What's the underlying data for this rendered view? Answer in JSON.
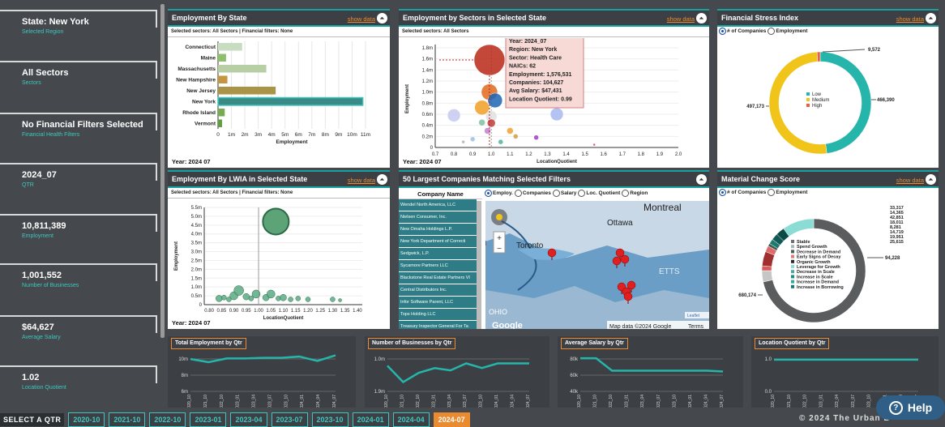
{
  "sidebar": [
    {
      "value": "State: New York",
      "sub": "Selected Region"
    },
    {
      "value": "All Sectors",
      "sub": "Sectors"
    },
    {
      "value": "No Financial Filters Selected",
      "sub": "Financial Health Filters"
    },
    {
      "value": "2024_07",
      "sub": "QTR"
    },
    {
      "value": "10,811,389",
      "sub": "Employment"
    },
    {
      "value": "1,001,552",
      "sub": "Number of Businesses"
    },
    {
      "value": "$64,627",
      "sub": "Average Salary"
    },
    {
      "value": "1.02",
      "sub": "Location Quotient"
    }
  ],
  "show_data": "show data",
  "p1": {
    "title": "Employment By State",
    "sub": "Selected sectors: All Sectors | Financial filters: None",
    "year": "Year: 2024  07",
    "xlabel": "Employment",
    "states": [
      "Connecticut",
      "Maine",
      "Massachusetts",
      "New Hampshire",
      "New Jersey",
      "New York",
      "Rhode Island",
      "Vermont"
    ],
    "values": [
      1.8,
      0.6,
      3.6,
      0.7,
      4.3,
      10.8,
      0.5,
      0.3
    ],
    "xticks": [
      "0",
      "1m",
      "2m",
      "3m",
      "4m",
      "5m",
      "6m",
      "7m",
      "8m",
      "9m",
      "10m",
      "11m"
    ]
  },
  "p2": {
    "title": "Employment by Sectors in Selected State",
    "sub": "Selected sectors: All Sectors",
    "year": "Year: 2024  07",
    "xlabel": "LocationQuotient",
    "ylabel": "Employment",
    "xticks": [
      "0.7",
      "0.8",
      "0.9",
      "1.0",
      "1.1",
      "1.2",
      "1.3",
      "1.4",
      "1.5",
      "1.6",
      "1.7",
      "1.8",
      "1.9",
      "2.0"
    ],
    "yticks": [
      "0",
      "0.2m",
      "0.4m",
      "0.6m",
      "0.8m",
      "1.0m",
      "1.2m",
      "1.4m",
      "1.6m",
      "1.8m"
    ],
    "tooltip": [
      "Year: 2024_07",
      "Region: New York",
      "Sector: Health Care",
      "NAICs: 62",
      "Employment: 1,576,531",
      "Companies: 104,627",
      "Avg Salary: $47,431",
      "Location Quotient: 0.99"
    ]
  },
  "p3": {
    "title": "Financial Stress Index",
    "r1": "# of Companies",
    "r2": "Employment",
    "legend": [
      "Low",
      "Medium",
      "High"
    ],
    "labels": [
      "9,572",
      "497,173",
      "466,390"
    ]
  },
  "p4": {
    "title": "Employment By LWIA in Selected State",
    "sub": "Selected sectors: All Sectors | Financial filters: None",
    "year": "Year: 2024  07",
    "xlabel": "LocationQuotient",
    "ylabel": "Employment",
    "xticks": [
      "0.80",
      "0.85",
      "0.90",
      "0.95",
      "1.00",
      "1.05",
      "1.10",
      "1.15",
      "1.20",
      "1.25",
      "1.30",
      "1.35",
      "1.40"
    ],
    "yticks": [
      "0",
      "0.5m",
      "1.0m",
      "1.5m",
      "2.0m",
      "2.5m",
      "3.0m",
      "3.5m",
      "4.0m",
      "4.5m",
      "5.0m",
      "5.5m"
    ]
  },
  "p5": {
    "title": "50 Largest Companies Matching Selected Filters",
    "col": "Company Name",
    "radios": [
      "Employ.",
      "Companies",
      "Salary",
      "Loc. Quotient",
      "Region"
    ],
    "companies": [
      "Wendel North America, LLC",
      "Nielsen Consumer, Inc.",
      "New Omaha Holdings L.P.",
      "New York Department of Correcti",
      "Sedgwick, L.P.",
      "Sycamore Partners LLC",
      "Blackstone Real Estate Partners VI",
      "Central Distributors Inc.",
      "Infor Software Parent, LLC",
      "Tops Holding LLC",
      "Treasury Inspector General For Ta"
    ],
    "map": {
      "montreal": "Montreal",
      "ottawa": "Ottawa",
      "toronto": "Toronto",
      "etts": "ETTS",
      "ohio": "OHIO",
      "leaflet": "Leaflet",
      "mapdata": "Map data ©2024 Google",
      "terms": "Terms",
      "google": "Google",
      "plus": "+",
      "minus": "−",
      "an": "AN"
    }
  },
  "p6": {
    "title": "Material Change Score",
    "r1": "# of Companies",
    "r2": "Employment",
    "legend": [
      "Stable",
      "Spend Growth",
      "Decrease in Demand",
      "Early Signs of Decay",
      "Organic Growth",
      "Leverage for Growth",
      "Decrease in Scale",
      "Increase in Scale",
      "Increase in Demand",
      "Increase in Borrowing"
    ],
    "labels": [
      "33,317",
      "14,365",
      "42,851",
      "18,011",
      "8,281",
      "14,719",
      "19,951",
      "25,615",
      "94,228",
      "680,174"
    ]
  },
  "bottom": [
    {
      "title": "Total Employment by Qtr",
      "yticks": [
        "10m",
        "8m",
        "6m"
      ],
      "values": [
        10.2,
        9.7,
        10.3,
        10.3,
        10.4,
        10.4,
        10.6,
        9.9,
        10.8
      ]
    },
    {
      "title": "Number of Businesses by Qtr",
      "yticks": [
        "1.0m",
        "1.9m"
      ],
      "values": [
        0.99,
        0.92,
        0.96,
        0.98,
        0.97,
        1.0,
        0.98,
        1.0,
        1.0,
        1.0
      ]
    },
    {
      "title": "Average Salary by Qtr",
      "yticks": [
        "80k",
        "60k",
        "40k"
      ],
      "values": [
        80,
        80,
        65,
        65,
        65,
        65,
        65,
        65,
        65,
        64
      ]
    },
    {
      "title": "Location Quotient by Qtr",
      "yticks": [
        "1.0",
        "0.0"
      ],
      "values": [
        1.02,
        1.02,
        1.02,
        1.02,
        1.02,
        1.02,
        1.02,
        1.02
      ]
    }
  ],
  "xq": [
    "2020_10",
    "2021_10",
    "2022_10",
    "2023_01",
    "2023_04",
    "2023_07",
    "2023_10",
    "2024_01",
    "2024_04",
    "2024_07"
  ],
  "qbar": {
    "label": "SELECT A QTR",
    "quarters": [
      "2020-10",
      "2021-10",
      "2022-10",
      "2023-01",
      "2023-04",
      "2023-07",
      "2023-10",
      "2024-01",
      "2024-04",
      "2024-07"
    ]
  },
  "help": "Help",
  "copyright": "© 2024 The Urban B"
}
